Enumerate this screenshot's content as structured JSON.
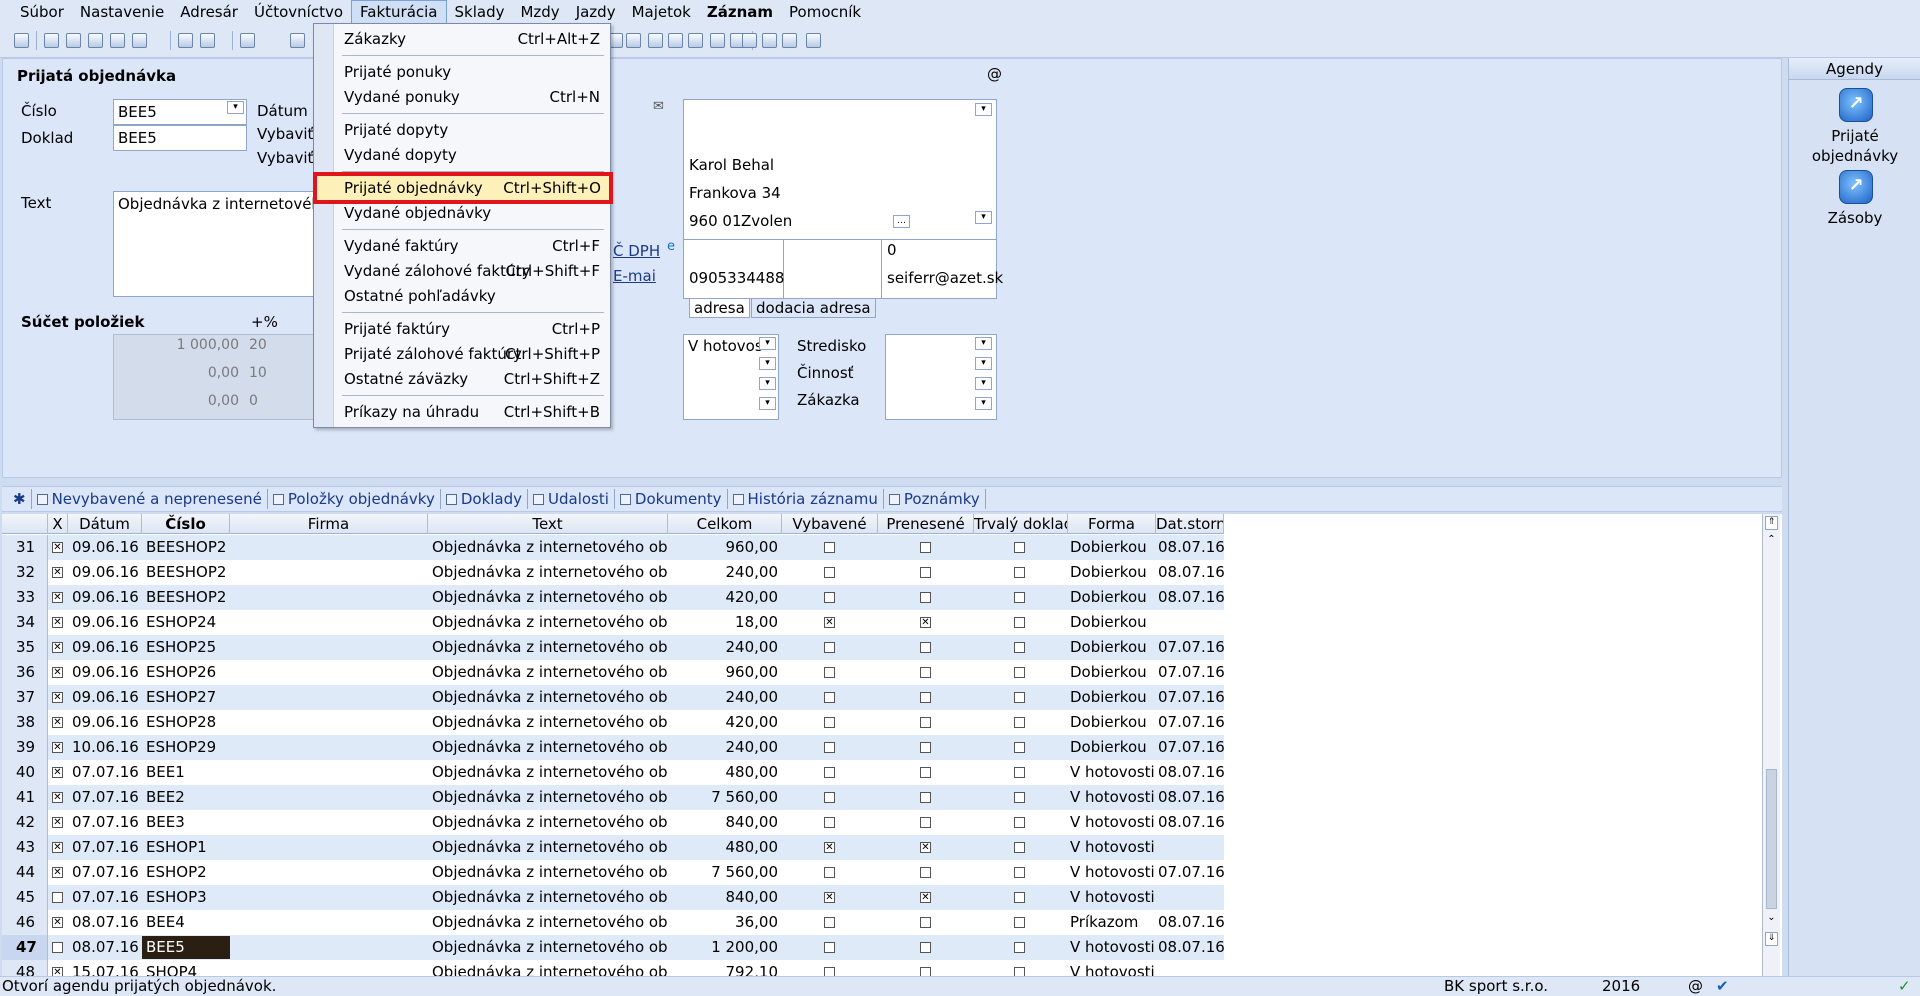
{
  "menubar": [
    "Súbor",
    "Nastavenie",
    "Adresár",
    "Účtovníctvo",
    "Fakturácia",
    "Sklady",
    "Mzdy",
    "Jazdy",
    "Majetok",
    "Záznam",
    "Pomocník"
  ],
  "dropdown": {
    "items": [
      {
        "label": "Zákazky",
        "shortcut": "Ctrl+Alt+Z"
      },
      {
        "label": "Prijaté ponuky",
        "shortcut": ""
      },
      {
        "label": "Vydané ponuky",
        "shortcut": "Ctrl+N"
      },
      {
        "label": "Prijaté dopyty",
        "shortcut": ""
      },
      {
        "label": "Vydané dopyty",
        "shortcut": ""
      },
      {
        "label": "Prijaté objednávky",
        "shortcut": "Ctrl+Shift+O"
      },
      {
        "label": "Vydané objednávky",
        "shortcut": ""
      },
      {
        "label": "Vydané faktúry",
        "shortcut": "Ctrl+F"
      },
      {
        "label": "Vydané zálohové faktúry",
        "shortcut": "Ctrl+Shift+F"
      },
      {
        "label": "Ostatné pohľadávky",
        "shortcut": ""
      },
      {
        "label": "Prijaté faktúry",
        "shortcut": "Ctrl+P"
      },
      {
        "label": "Prijaté zálohové faktúry",
        "shortcut": "Ctrl+Shift+P"
      },
      {
        "label": "Ostatné záväzky",
        "shortcut": "Ctrl+Shift+Z"
      },
      {
        "label": "Príkazy na úhradu",
        "shortcut": "Ctrl+Shift+B"
      }
    ]
  },
  "form": {
    "title": "Prijatá objednávka",
    "cislo_label": "Číslo",
    "cislo_value": "BEE5",
    "doklad_label": "Doklad",
    "doklad_value": "BEE5",
    "datum_label": "Dátum z",
    "vybavit1_label": "Vybaviť",
    "vybavit2_label": "Vybaviť",
    "text_label": "Text",
    "text_value": "Objednávka z internetového o",
    "sucet_label": "Súčet položiek",
    "pct_label": "+%",
    "sums": [
      {
        "amount": "1 000,00",
        "pct": "20"
      },
      {
        "amount": "0,00",
        "pct": "10"
      },
      {
        "amount": "0,00",
        "pct": "0"
      }
    ],
    "at_sign": "@",
    "dph_link": "Č DPH",
    "email_link": "E-mai",
    "address": {
      "name": "Karol Behal",
      "street": "Frankova 34",
      "zip": "960 01",
      "city": "Zvolen",
      "phone": "0905334488",
      "zero": "0",
      "email": "seiferr@azet.sk"
    },
    "addr_tabs": [
      "adresa",
      "dodacia adresa"
    ],
    "payment": "V hotovos",
    "stredisko_label": "Stredisko",
    "cinnost_label": "Činnosť",
    "zakazka_label": "Zákazka"
  },
  "agendy": {
    "title": "Agendy",
    "items": [
      "Prijaté objednávky",
      "Zásoby"
    ]
  },
  "tabs": [
    "Nevybavené a neprenesené",
    "Položky objednávky",
    "Doklady",
    "Udalosti",
    "Dokumenty",
    "História záznamu",
    "Poznámky"
  ],
  "grid": {
    "headers": [
      "X",
      "Dátum",
      "Číslo",
      "Firma",
      "Text",
      "Celkom",
      "Vybavené",
      "Prenesené",
      "Trvalý doklad",
      "Forma",
      "Dat.storna"
    ],
    "rows": [
      {
        "n": "31",
        "x": true,
        "datum": "09.06.16",
        "cislo": "BEESHOP2",
        "text": "Objednávka z internetového obcho",
        "celkom": "960,00",
        "vyb": false,
        "pren": false,
        "forma": "Dobierkou",
        "storno": "08.07.16"
      },
      {
        "n": "32",
        "x": true,
        "datum": "09.06.16",
        "cislo": "BEESHOP2",
        "text": "Objednávka z internetového obcho",
        "celkom": "240,00",
        "vyb": false,
        "pren": false,
        "forma": "Dobierkou",
        "storno": "08.07.16"
      },
      {
        "n": "33",
        "x": true,
        "datum": "09.06.16",
        "cislo": "BEESHOP2",
        "text": "Objednávka z internetového obcho",
        "celkom": "420,00",
        "vyb": false,
        "pren": false,
        "forma": "Dobierkou",
        "storno": "08.07.16"
      },
      {
        "n": "34",
        "x": true,
        "datum": "09.06.16",
        "cislo": "ESHOP24",
        "text": "Objednávka z internetového obcho",
        "celkom": "18,00",
        "vyb": true,
        "pren": true,
        "forma": "Dobierkou",
        "storno": ""
      },
      {
        "n": "35",
        "x": true,
        "datum": "09.06.16",
        "cislo": "ESHOP25",
        "text": "Objednávka z internetového obcho",
        "celkom": "240,00",
        "vyb": false,
        "pren": false,
        "forma": "Dobierkou",
        "storno": "07.07.16"
      },
      {
        "n": "36",
        "x": true,
        "datum": "09.06.16",
        "cislo": "ESHOP26",
        "text": "Objednávka z internetového obcho",
        "celkom": "960,00",
        "vyb": false,
        "pren": false,
        "forma": "Dobierkou",
        "storno": "07.07.16"
      },
      {
        "n": "37",
        "x": true,
        "datum": "09.06.16",
        "cislo": "ESHOP27",
        "text": "Objednávka z internetového obcho",
        "celkom": "240,00",
        "vyb": false,
        "pren": false,
        "forma": "Dobierkou",
        "storno": "07.07.16"
      },
      {
        "n": "38",
        "x": true,
        "datum": "09.06.16",
        "cislo": "ESHOP28",
        "text": "Objednávka z internetového obcho",
        "celkom": "420,00",
        "vyb": false,
        "pren": false,
        "forma": "Dobierkou",
        "storno": "07.07.16"
      },
      {
        "n": "39",
        "x": true,
        "datum": "10.06.16",
        "cislo": "ESHOP29",
        "text": "Objednávka z internetového obcho",
        "celkom": "240,00",
        "vyb": false,
        "pren": false,
        "forma": "Dobierkou",
        "storno": "07.07.16"
      },
      {
        "n": "40",
        "x": true,
        "datum": "07.07.16",
        "cislo": "BEE1",
        "text": "Objednávka z internetového obcho",
        "celkom": "480,00",
        "vyb": false,
        "pren": false,
        "forma": "V hotovosti",
        "storno": "08.07.16"
      },
      {
        "n": "41",
        "x": true,
        "datum": "07.07.16",
        "cislo": "BEE2",
        "text": "Objednávka z internetového obcho",
        "celkom": "7 560,00",
        "vyb": false,
        "pren": false,
        "forma": "V hotovosti",
        "storno": "08.07.16"
      },
      {
        "n": "42",
        "x": true,
        "datum": "07.07.16",
        "cislo": "BEE3",
        "text": "Objednávka z internetového obcho",
        "celkom": "840,00",
        "vyb": false,
        "pren": false,
        "forma": "V hotovosti",
        "storno": "08.07.16"
      },
      {
        "n": "43",
        "x": true,
        "datum": "07.07.16",
        "cislo": "ESHOP1",
        "text": "Objednávka z internetového obcho",
        "celkom": "480,00",
        "vyb": true,
        "pren": true,
        "forma": "V hotovosti",
        "storno": ""
      },
      {
        "n": "44",
        "x": true,
        "datum": "07.07.16",
        "cislo": "ESHOP2",
        "text": "Objednávka z internetového obcho",
        "celkom": "7 560,00",
        "vyb": false,
        "pren": false,
        "forma": "V hotovosti",
        "storno": "07.07.16"
      },
      {
        "n": "45",
        "x": false,
        "datum": "07.07.16",
        "cislo": "ESHOP3",
        "text": "Objednávka z internetového obcho",
        "celkom": "840,00",
        "vyb": true,
        "pren": true,
        "forma": "V hotovosti",
        "storno": ""
      },
      {
        "n": "46",
        "x": true,
        "datum": "08.07.16",
        "cislo": "BEE4",
        "text": "Objednávka z internetového obcho",
        "celkom": "36,00",
        "vyb": false,
        "pren": false,
        "forma": "Príkazom",
        "storno": "08.07.16"
      },
      {
        "n": "47",
        "x": false,
        "datum": "08.07.16",
        "cislo": "BEE5",
        "text": "Objednávka z internetového obcho",
        "celkom": "1 200,00",
        "vyb": false,
        "pren": false,
        "forma": "V hotovosti",
        "storno": "08.07.16"
      },
      {
        "n": "48",
        "x": true,
        "datum": "15.07.16",
        "cislo": "SHOP4",
        "text": "Objednávka z internetového obcho",
        "celkom": "792,10",
        "vyb": false,
        "pren": false,
        "forma": "V hotovosti",
        "storno": ""
      }
    ]
  },
  "status": {
    "message": "Otvorí agendu prijatých objednávok.",
    "company": "BK sport  s.r.o.",
    "year": "2016",
    "at": "@"
  }
}
